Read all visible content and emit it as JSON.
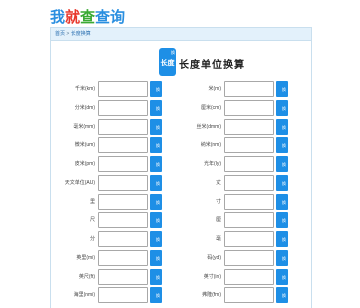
{
  "site": {
    "logo": [
      "我",
      "就",
      "查",
      "查询"
    ]
  },
  "breadcrumb": {
    "home": "首页",
    "separator": ">",
    "current": "长度换算"
  },
  "app": {
    "icon_label": "长度",
    "icon_tag": "换",
    "title": "长度单位换算"
  },
  "converter": {
    "button_label": "换",
    "left_units": [
      {
        "label": "千米(km)",
        "value": ""
      },
      {
        "label": "分米(dm)",
        "value": ""
      },
      {
        "label": "毫米(mm)",
        "value": ""
      },
      {
        "label": "微米(um)",
        "value": ""
      },
      {
        "label": "皮米(pm)",
        "value": ""
      },
      {
        "label": "天文单位(AU)",
        "value": ""
      },
      {
        "label": "里",
        "value": ""
      },
      {
        "label": "尺",
        "value": ""
      },
      {
        "label": "分",
        "value": ""
      },
      {
        "label": "英里(mi)",
        "value": ""
      },
      {
        "label": "英尺(ft)",
        "value": ""
      },
      {
        "label": "海里(nmi)",
        "value": ""
      }
    ],
    "right_units": [
      {
        "label": "米(m)",
        "value": ""
      },
      {
        "label": "厘米(cm)",
        "value": ""
      },
      {
        "label": "丝米(dmm)",
        "value": ""
      },
      {
        "label": "纳米(nm)",
        "value": ""
      },
      {
        "label": "光年(ly)",
        "value": ""
      },
      {
        "label": "丈",
        "value": ""
      },
      {
        "label": "寸",
        "value": ""
      },
      {
        "label": "厘",
        "value": ""
      },
      {
        "label": "毫",
        "value": ""
      },
      {
        "label": "码(yd)",
        "value": ""
      },
      {
        "label": "英寸(in)",
        "value": ""
      },
      {
        "label": "弗隆(fm)",
        "value": ""
      }
    ]
  }
}
